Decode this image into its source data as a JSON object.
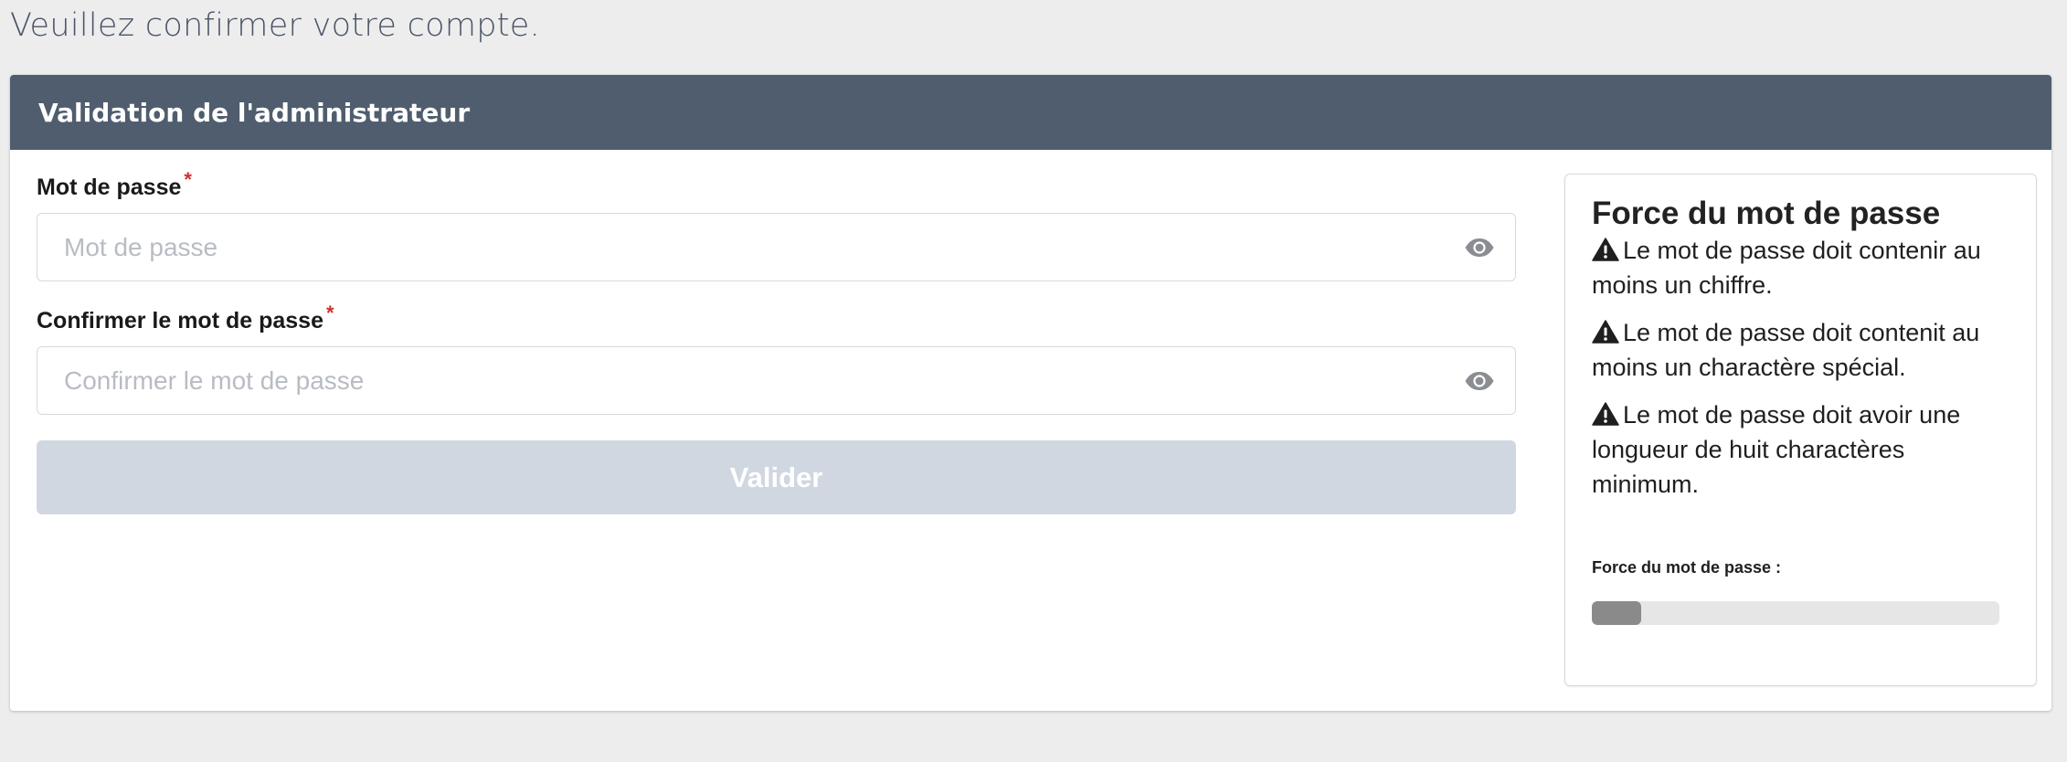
{
  "page": {
    "heading": "Veuillez confirmer votre compte."
  },
  "card": {
    "title": "Validation de l'administrateur"
  },
  "form": {
    "password": {
      "label": "Mot de passe",
      "required_mark": "*",
      "placeholder": "Mot de passe",
      "value": "",
      "toggle_icon": "eye-icon"
    },
    "confirm_password": {
      "label": "Confirmer le mot de passe",
      "required_mark": "*",
      "placeholder": "Confirmer le mot de passe",
      "value": "",
      "toggle_icon": "eye-icon"
    },
    "submit_label": "Valider",
    "submit_enabled": false
  },
  "strength": {
    "title": "Force du mot de passe",
    "rules": [
      {
        "icon": "warning-icon",
        "text": "Le mot de passe doit contenir au moins un chiffre."
      },
      {
        "icon": "warning-icon",
        "text": "Le mot de passe doit contenit au moins un charactère spécial."
      },
      {
        "icon": "warning-icon",
        "text": "Le mot de passe doit avoir une longueur de huit charactères minimum."
      }
    ],
    "meter_label": "Force du mot de passe :",
    "meter_level": 0.12
  },
  "colors": {
    "header_bg": "#4f5d6e",
    "required": "#d0312d",
    "button_disabled": "#d1d7e0",
    "meter_fill": "#8a8a8a",
    "meter_track": "#e6e6e6"
  }
}
